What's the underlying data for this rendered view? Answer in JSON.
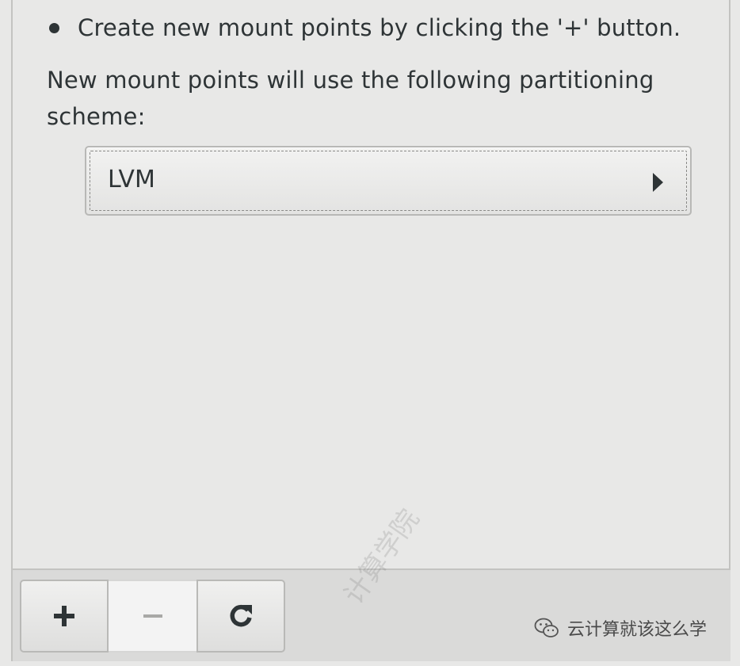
{
  "instructions": {
    "bullet_text": "Create new mount points by clicking the '+' button.",
    "scheme_text": "New mount points will use the following partitioning scheme:"
  },
  "partition_scheme": {
    "selected": "LVM"
  },
  "toolbar": {
    "add_icon": "plus-icon",
    "remove_icon": "minus-icon",
    "refresh_icon": "refresh-icon",
    "remove_enabled": false
  },
  "watermark": {
    "text": "云计算就该这么学",
    "diagonal_text": "计算学院",
    "icon": "wechat-icon"
  }
}
